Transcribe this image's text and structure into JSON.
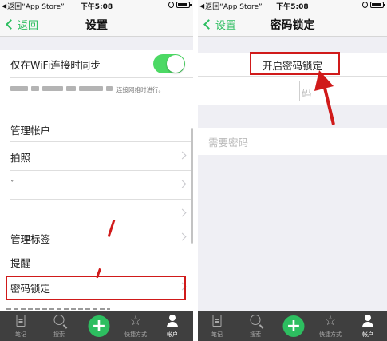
{
  "status_bar": {
    "back_label": "返回“App Store”",
    "time": "下午5:08"
  },
  "left_screen": {
    "nav": {
      "back_label": "返回",
      "title": "设置"
    },
    "rows": {
      "wifi_sync": "仅在WiFi连接时同步",
      "sync_note": "连接网络时进行。",
      "manage_account": "管理帐户",
      "camera": "拍照",
      "blank_row_1": "",
      "blank_row_2": "",
      "manage_tags": "管理标签",
      "reminders": "提醒",
      "passcode_lock": "密码锁定"
    },
    "wifi_sync_enabled": true
  },
  "right_screen": {
    "nav": {
      "back_label": "设置",
      "title": "密码锁定"
    },
    "rows": {
      "enable_passcode": "开启密码锁定",
      "change_passcode_partial": "码",
      "require_passcode": "需要密码"
    }
  },
  "tab_bar": {
    "items": [
      {
        "label": "笔记",
        "icon": "note-icon"
      },
      {
        "label": "搜索",
        "icon": "search-icon"
      },
      {
        "label": "",
        "icon": "add-icon"
      },
      {
        "label": "快捷方式",
        "icon": "star-icon"
      },
      {
        "label": "帐户",
        "icon": "account-icon"
      }
    ],
    "active_index": 4
  },
  "colors": {
    "accent_green": "#2dbe60",
    "toggle_green": "#4cd964",
    "highlight_red": "#d01a1a",
    "tab_bar_bg": "#3f3f3f"
  }
}
